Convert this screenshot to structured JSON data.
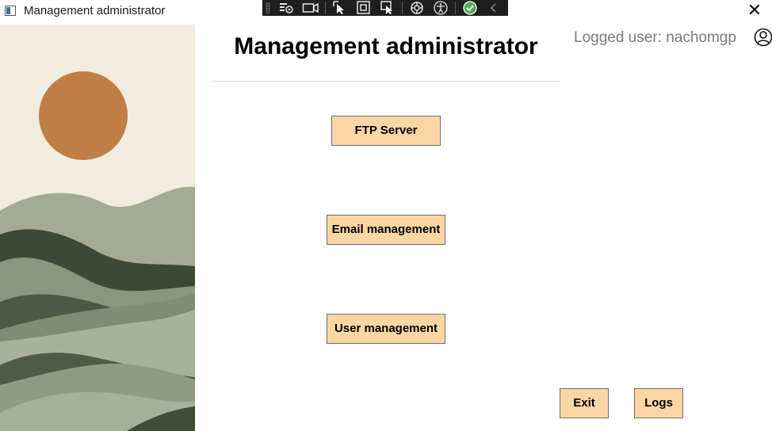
{
  "window": {
    "title": "Management administrator",
    "close_glyph": "✕"
  },
  "debug_toolbar": {
    "buttons": [
      {
        "icon": "live-visual-tree-icon"
      },
      {
        "icon": "record-icon"
      },
      {
        "icon": "select-element-icon"
      },
      {
        "icon": "display-layout-adorners-icon"
      },
      {
        "icon": "track-focus-icon"
      },
      {
        "icon": "hot-reload-icon"
      },
      {
        "icon": "accessibility-icon"
      },
      {
        "icon": "checkmark-status-icon"
      },
      {
        "icon": "collapse-toolbar-icon"
      }
    ],
    "status_color": "#4caf50"
  },
  "header": {
    "title": "Management administrator",
    "logged_user": "Logged user: nachomgp",
    "user_icon": "user-circle-icon"
  },
  "menu": {
    "ftp_label": "FTP Server",
    "email_label": "Email management",
    "user_label": "User management"
  },
  "footer": {
    "exit_label": "Exit",
    "logs_label": "Logs"
  },
  "colors": {
    "button_bg": "#fad6a5",
    "button_border": "#6f6f6f",
    "sun": "#c27f45",
    "sky": "#f2ebe0"
  }
}
